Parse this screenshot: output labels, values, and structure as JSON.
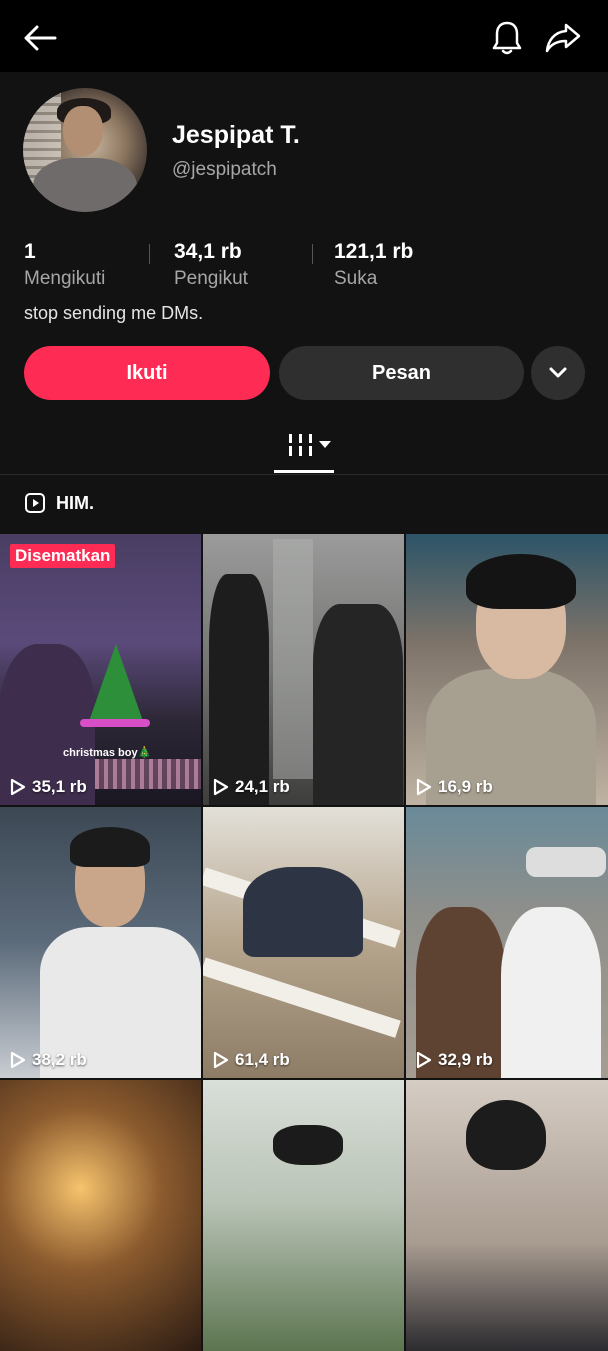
{
  "header": {
    "back_icon": "arrow-left-icon",
    "bell_icon": "bell-icon",
    "share_icon": "share-arrow-icon"
  },
  "profile": {
    "name": "Jespipat T.",
    "handle": "@jespipatch",
    "bio": "stop sending me DMs."
  },
  "stats": [
    {
      "value": "1",
      "label": "Mengikuti"
    },
    {
      "value": "34,1 rb",
      "label": "Pengikut"
    },
    {
      "value": "121,1 rb",
      "label": "Suka"
    }
  ],
  "actions": {
    "follow_label": "Ikuti",
    "message_label": "Pesan",
    "more_icon": "chevron-down-icon",
    "follow_color": "#fe2c55"
  },
  "tabs": {
    "grid_icon": "video-grid-icon"
  },
  "playlist": {
    "label": "HIM.",
    "icon": "play-square-icon"
  },
  "videos": [
    {
      "views": "35,1 rb",
      "badge": "Disematkan",
      "caption": "christmas boy🎄"
    },
    {
      "views": "24,1 rb"
    },
    {
      "views": "16,9 rb"
    },
    {
      "views": "38,2 rb"
    },
    {
      "views": "61,4 rb"
    },
    {
      "views": "32,9 rb"
    },
    {
      "views": ""
    },
    {
      "views": ""
    },
    {
      "views": ""
    }
  ]
}
